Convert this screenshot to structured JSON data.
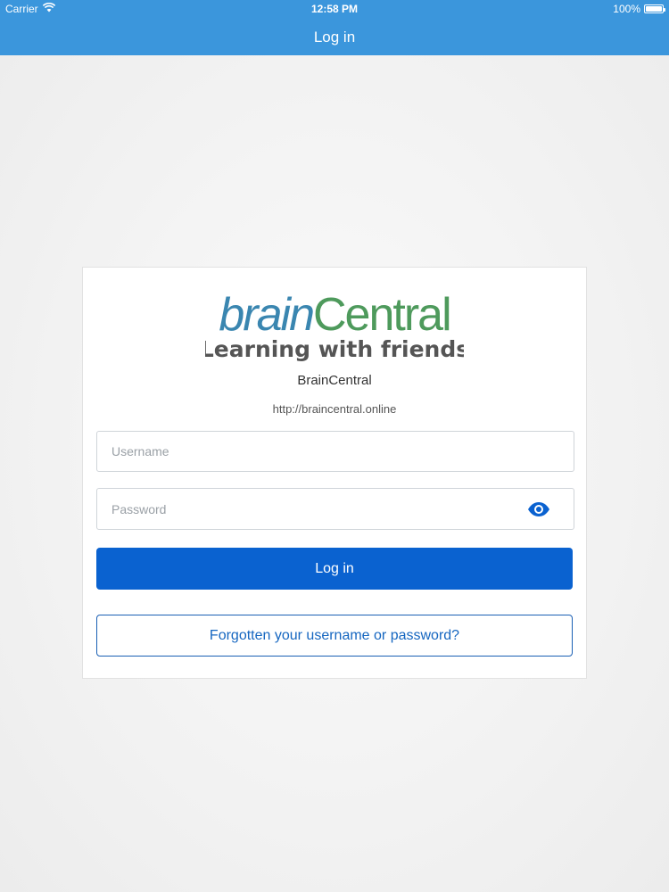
{
  "status_bar": {
    "carrier": "Carrier",
    "time": "12:58 PM",
    "battery": "100%",
    "battery_level": 1.0,
    "wifi_icon": "wifi-icon",
    "battery_icon": "battery-icon"
  },
  "nav": {
    "title": "Log in"
  },
  "logo": {
    "brain": "brain",
    "central": "Central",
    "tagline": "Learning with friends",
    "colors": {
      "brain": "#3a86b0",
      "central": "#4e9a5c",
      "tagline": "#555555"
    }
  },
  "site": {
    "name": "BrainCentral",
    "url": "http://braincentral.online"
  },
  "form": {
    "username_placeholder": "Username",
    "username_value": "",
    "password_placeholder": "Password",
    "password_value": "",
    "reveal_icon": "eye-icon",
    "login_label": "Log in",
    "forgot_label": "Forgotten your username or password?"
  },
  "colors": {
    "header": "#3b96dc",
    "primary_button": "#0a62d0",
    "link": "#1566c0"
  }
}
